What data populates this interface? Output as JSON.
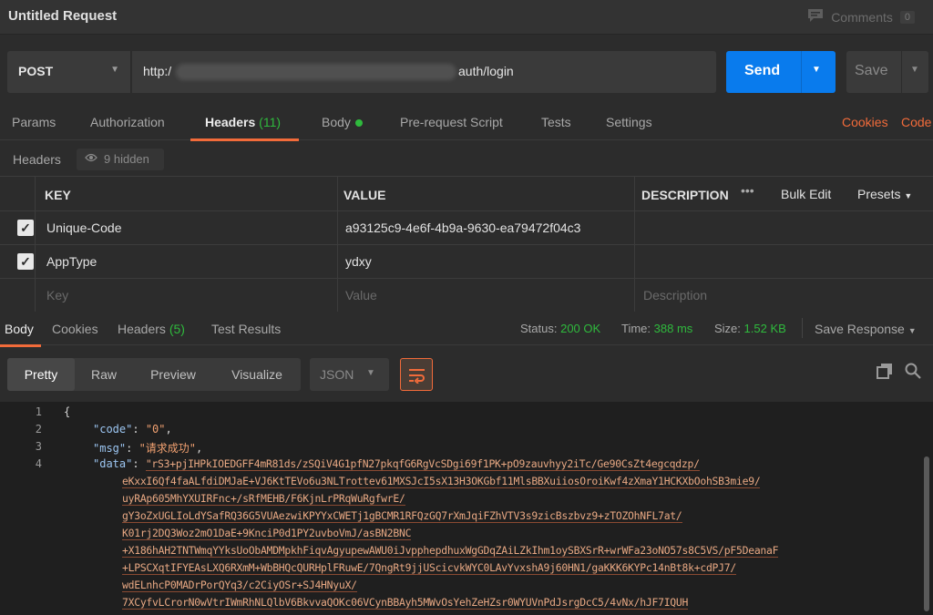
{
  "window": {
    "title": "Untitled Request",
    "comments_label": "Comments",
    "comments_count": "0"
  },
  "request": {
    "method": "POST",
    "url_prefix": "http:/",
    "url_suffix": "auth/login",
    "send_label": "Send",
    "save_label": "Save"
  },
  "tabs": {
    "params": "Params",
    "authorization": "Authorization",
    "headers": "Headers",
    "headers_count": "(11)",
    "body": "Body",
    "prerequest": "Pre-request Script",
    "tests": "Tests",
    "settings": "Settings",
    "cookies": "Cookies",
    "code": "Code"
  },
  "headers_section": {
    "label": "Headers",
    "hidden_label": "9 hidden"
  },
  "headers_table": {
    "columns": {
      "key": "KEY",
      "value": "VALUE",
      "description": "DESCRIPTION"
    },
    "more": "•••",
    "bulk_edit": "Bulk Edit",
    "presets": "Presets",
    "rows": [
      {
        "key": "Unique-Code",
        "value": "a93125c9-4e6f-4b9a-9630-ea79472f04c3",
        "checked": true
      },
      {
        "key": "AppType",
        "value": "ydxy",
        "checked": true
      }
    ],
    "placeholders": {
      "key": "Key",
      "value": "Value",
      "description": "Description"
    }
  },
  "response": {
    "tabs": {
      "body": "Body",
      "cookies": "Cookies",
      "headers": "Headers",
      "headers_count": "(5)",
      "test_results": "Test Results"
    },
    "status_label": "Status:",
    "status_value": "200 OK",
    "time_label": "Time:",
    "time_value": "388 ms",
    "size_label": "Size:",
    "size_value": "1.52 KB",
    "save_response": "Save Response",
    "view_modes": {
      "pretty": "Pretty",
      "raw": "Raw",
      "preview": "Preview",
      "visualize": "Visualize"
    },
    "format": "JSON"
  },
  "code": {
    "line_numbers": [
      "1",
      "2",
      "3",
      "4"
    ],
    "open_brace": "{",
    "code_key": "\"code\"",
    "code_val": "\"0\"",
    "msg_key": "\"msg\"",
    "msg_val": "\"请求成功\"",
    "data_key": "\"data\"",
    "data_lines": [
      "\"rS3+pjIHPkIOEDGFF4mR81ds/zSQiV4G1pfN27pkqfG6RgVcSDgi69f1PK+pO9zauvhyy2iTc/Ge90CsZt4egcqdzp/",
      "eKxxI6Qf4faALfdiDMJaE+VJ6KtTEVo6u3NLTrottev61MXSJcI5sX13H3OKGbf11MlsBBXuiiosOroiKwf4zXmaY1HCKXbOohSB3mie9/",
      "uyRAp605MhYXUIRFnc+/sRfMEHB/F6KjnLrPRqWuRgfwrE/",
      "gY3oZxUGLIoLdYSafRQ36G5VUAezwiKPYYxCWETj1gBCMR1RFQzGQ7rXmJqiFZhVTV3s9zicBszbvz9+zTOZOhNFL7at/",
      "K01rj2DQ3Woz2mO1DaE+9KnciP0d1PY2uvboVmJ/asBN2BNC",
      "+X186hAH2TNTWmqYYksUoObAMDMpkhFiqvAgyupewAWU0iJvpphepdhuxWgGDqZAiLZkIhm1oySBXSrR+wrWFa23oNO57s8C5VS/pF5DeanaF",
      "+LPSCXqtIFYEAsLXQ6RXmM+WbBHQcQURHplFRuwE/7QngRt9jjUScicvkWYC0LAvYvxshA9j60HN1/gaKKK6KYPc14nBt8k+cdPJ7/",
      "wdELnhcP0MADrPorQYq3/c2CiyOSr+SJ4HNyuX/",
      "7XCyfvLCrorN0wVtrIWmRhNLQlbV6BkvvaQOKc06VCynBBAyh5MWvOsYehZeHZsr0WYUVnPdJsrgDcC5/4vNx/hJF7IQUH"
    ]
  }
}
